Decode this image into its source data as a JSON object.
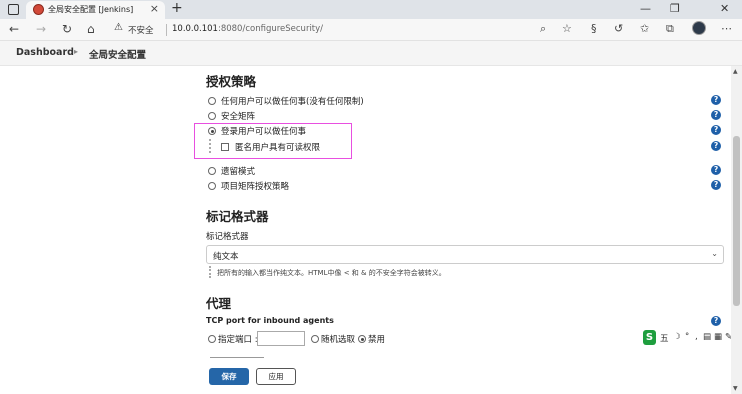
{
  "browser": {
    "tab_title": "全局安全配置 [Jenkins]",
    "tab_close": "×",
    "new_tab": "+",
    "insecure_label": "不安全",
    "url_host": "10.0.0.101",
    "url_rest": ":8080/configureSecurity/",
    "icons": [
      "back-icon",
      "forward-icon",
      "reload-icon",
      "home-icon",
      "warning-icon",
      "zoom-icon",
      "favorite-add-icon",
      "extension-icon",
      "refresh-icon",
      "favorites-icon",
      "collections-icon",
      "profile-icon",
      "more-icon"
    ]
  },
  "breadcrumb": {
    "items": [
      "Dashboard",
      "全局安全配置"
    ],
    "separator": "▸"
  },
  "authorization": {
    "heading": "授权策略",
    "options": [
      {
        "label": "任何用户可以做任何事(没有任何限制)",
        "selected": false
      },
      {
        "label": "安全矩阵",
        "selected": false
      },
      {
        "label": "登录用户可以做任何事",
        "selected": true
      },
      {
        "label": "匿名用户具有可读权限",
        "checkbox": true,
        "checked": false
      },
      {
        "label": "遗留模式",
        "selected": false
      },
      {
        "label": "项目矩阵授权策略",
        "selected": false
      }
    ],
    "highlight_color": "#e84fe0"
  },
  "markup": {
    "heading": "标记格式器",
    "field_label": "标记格式器",
    "selected_value": "纯文本",
    "note": "把所有的输入都当作纯文本。HTML中像 < 和 & 的不安全字符会被转义。"
  },
  "agent": {
    "heading": "代理",
    "port_label": "TCP port for inbound agents",
    "options": [
      {
        "label": "指定端口 :",
        "selected": false
      },
      {
        "label": "随机选取",
        "selected": false
      },
      {
        "label": "禁用",
        "selected": true
      }
    ],
    "port_value": ""
  },
  "buttons": {
    "save": "保存",
    "apply": "应用"
  },
  "ime": {
    "logo": "S",
    "mode": "五",
    "items": [
      "☽",
      "°",
      ",",
      "▤",
      "▦",
      "✎",
      "⋮"
    ]
  },
  "colors": {
    "accent": "#2566a8",
    "help": "#1e5fa8"
  }
}
